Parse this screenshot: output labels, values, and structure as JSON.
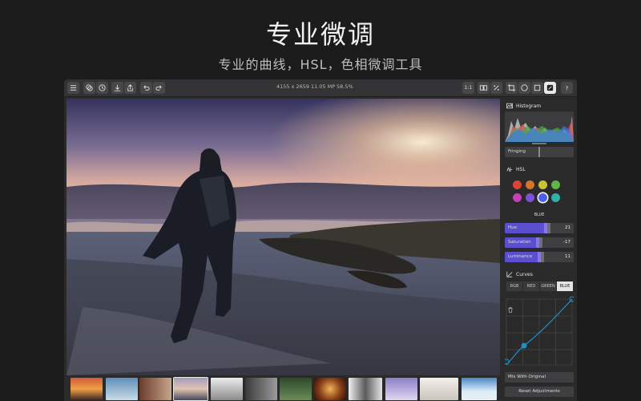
{
  "hero": {
    "title": "专业微调",
    "subtitle": "专业的曲线，HSL，色相微调工具"
  },
  "toolbar": {
    "left_icons": [
      "menu-icon",
      "layers-icon",
      "history-icon",
      "import-icon",
      "share-icon",
      "undo-icon",
      "redo-icon"
    ],
    "dimensions": "4155 x 2659",
    "megapixels": "11.05 MP",
    "zoom": "58.5%",
    "zoom_fit_label": "1:1",
    "right_icons": [
      "compare-icon",
      "percent-icon",
      "crop-icon",
      "circle-mask-icon",
      "frame-icon",
      "adjust-icon",
      "help-icon"
    ]
  },
  "panel": {
    "histogram": {
      "title": "Histogram"
    },
    "fringing": {
      "label": "Fringing",
      "level": 0.5
    },
    "hsl": {
      "title": "HSL",
      "selected_color_name": "BLUE",
      "colors": [
        "#d9443a",
        "#d2762c",
        "#c9c33a",
        "#5fb34a",
        "#c640b8",
        "#7c52d6",
        "#4d60e8",
        "#2fb3a6"
      ],
      "selected_index": 6,
      "sliders": [
        {
          "label": "Hue",
          "value": "21",
          "level": 0.62
        },
        {
          "label": "Saturation",
          "value": "-17",
          "level": 0.5
        },
        {
          "label": "Luminance",
          "value": "11",
          "level": 0.52
        }
      ]
    },
    "curves": {
      "title": "Curves",
      "tabs": [
        "RGB",
        "RED",
        "GREEN",
        "BLUE"
      ],
      "active_tab": 3
    },
    "mix_label": "Mix With Original",
    "reset_label": "Reset Adjustments"
  },
  "filmstrip": {
    "count": 12,
    "selected_index": 3
  },
  "colors": {
    "accent": "#5b4fd0",
    "curve": "#1e90c8"
  }
}
